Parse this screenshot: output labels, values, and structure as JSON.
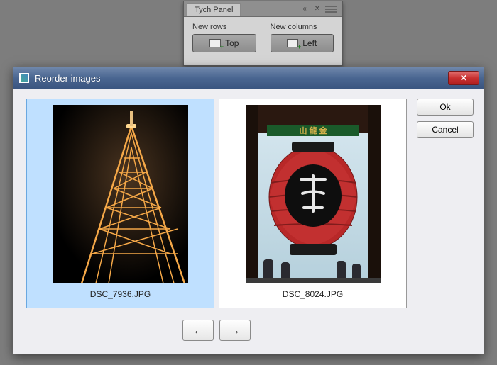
{
  "panel": {
    "title": "Tych Panel",
    "new_rows_label": "New rows",
    "new_columns_label": "New columns",
    "top_btn": "Top",
    "left_btn": "Left"
  },
  "dialog": {
    "title": "Reorder images",
    "ok": "Ok",
    "cancel": "Cancel",
    "nav_left": "←",
    "nav_right": "→",
    "thumbs": [
      {
        "caption": "DSC_7936.JPG",
        "selected": true
      },
      {
        "caption": "DSC_8024.JPG",
        "selected": false
      }
    ]
  }
}
